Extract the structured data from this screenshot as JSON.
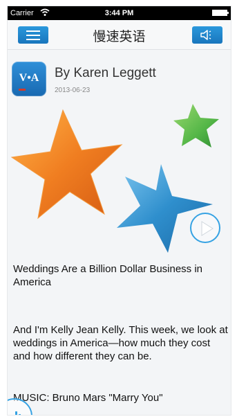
{
  "status_bar": {
    "carrier": "Carrier",
    "time": "3:44 PM"
  },
  "nav": {
    "title": "慢速英语",
    "menu_icon": "hamburger-menu-icon",
    "sound_icon": "speaker-icon"
  },
  "article_meta": {
    "author": "By Karen Leggett",
    "date": "2013-06-23",
    "logo_text": "V•A"
  },
  "hero": {
    "play_icon": "play-icon",
    "colors": {
      "orange_star": "#f07e21",
      "green_star": "#55b748",
      "blue_star": "#2f8fcd"
    }
  },
  "article": {
    "title": "Weddings Are a Billion Dollar Business in America",
    "paragraphs": [
      "And I'm Kelly Jean Kelly. This week, we look at weddings in America—how much they cost and how different they can be.",
      "MUSIC: Bruno Mars \"Marry You\""
    ]
  },
  "colors": {
    "accent": "#1f87d0"
  }
}
